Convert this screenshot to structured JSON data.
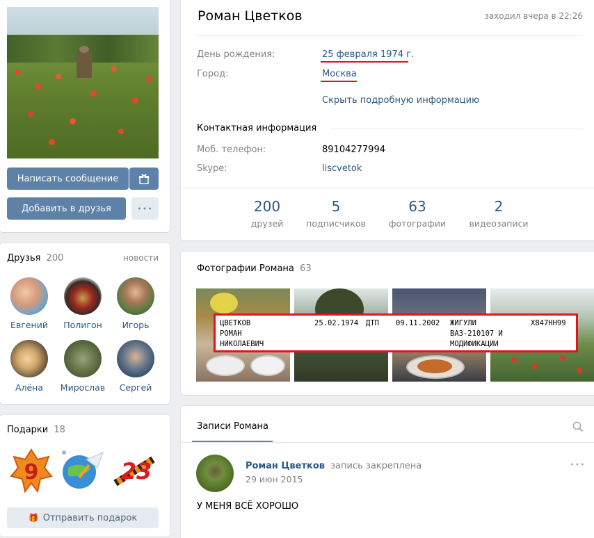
{
  "profile": {
    "name": "Роман Цветков",
    "last_seen": "заходил вчера в 22:26",
    "birthday_label": "День рождения:",
    "birthday_value": "25 февраля 1974 г.",
    "city_label": "Город:",
    "city_value": "Москва",
    "hide_info_link": "Скрыть подробную информацию",
    "contacts_header": "Контактная информация",
    "phone_label": "Моб. телефон:",
    "phone_value": "89104277994",
    "skype_label": "Skype:",
    "skype_value": "liscvetok"
  },
  "actions": {
    "message_button": "Написать сообщение",
    "add_friend_button": "Добавить в друзья",
    "more_button": "•••"
  },
  "stats": [
    {
      "count": "200",
      "label": "друзей"
    },
    {
      "count": "5",
      "label": "подписчиков"
    },
    {
      "count": "63",
      "label": "фотографии"
    },
    {
      "count": "2",
      "label": "видеозаписи"
    }
  ],
  "friends": {
    "title": "Друзья",
    "count": "200",
    "news_link": "новости",
    "list": [
      {
        "name": "Евгений"
      },
      {
        "name": "Полигон"
      },
      {
        "name": "Игорь"
      },
      {
        "name": "Алёна"
      },
      {
        "name": "Мирослав"
      },
      {
        "name": "Сергей"
      }
    ]
  },
  "gifts": {
    "title": "Подарки",
    "count": "18",
    "send_button": "Отправить подарок",
    "items": [
      {
        "icon": "gift-9-icon"
      },
      {
        "icon": "gift-rocket-icon"
      },
      {
        "icon": "gift-23-icon"
      }
    ]
  },
  "photos": {
    "title": "Фотографии Романа",
    "count": "63"
  },
  "overlay_record": {
    "surname": "ЦВЕТКОВ",
    "first_name": "РОМАН",
    "patronymic": "НИКОЛАЕВИЧ",
    "dob": "25.02.1974",
    "event": "ДТП",
    "date": "09.11.2002",
    "car_line1": "ЖИГУЛИ",
    "car_line2": "ВАЗ-210107 И",
    "car_line3": "МОДИФИКАЦИИ",
    "plate": "Х847НН99"
  },
  "wall": {
    "tab_label": "Записи Романа",
    "post_author": "Роман Цветков",
    "post_pinned": "запись закреплена",
    "post_date": "29 июн 2015",
    "post_text": "У МЕНЯ ВСЁ ХОРОШО",
    "post_more": "•••"
  },
  "colors": {
    "accent": "#5e81a8",
    "link": "#2a5885",
    "highlight_red": "#e0151b",
    "background": "#edeef0"
  }
}
